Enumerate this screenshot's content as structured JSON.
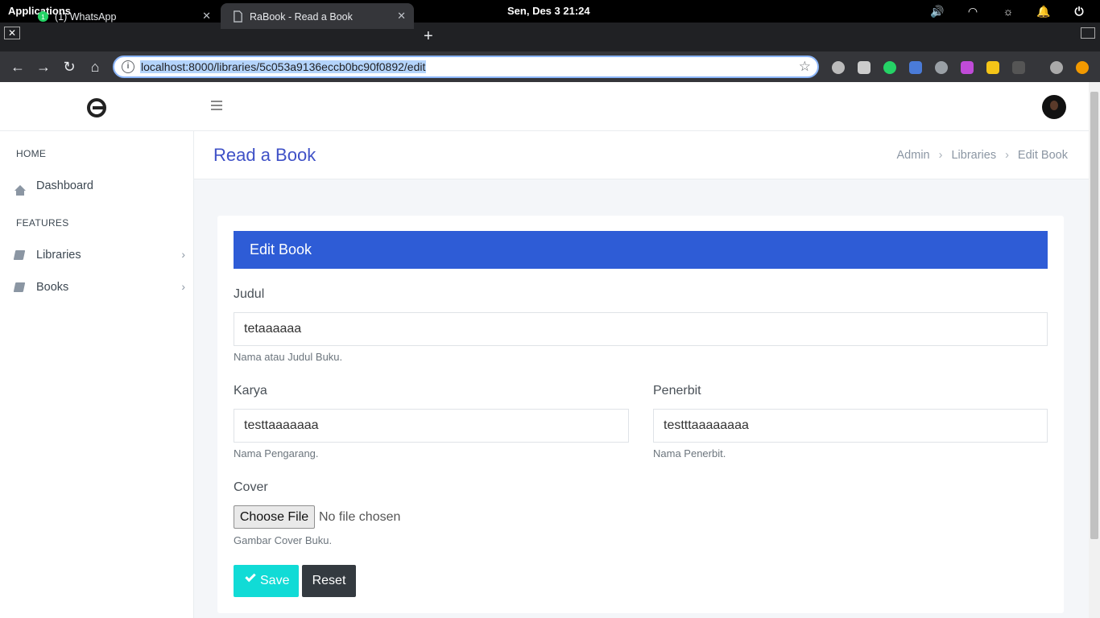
{
  "os": {
    "applications_label": "Applications",
    "clock": "Sen, Des 3    21:24"
  },
  "browser": {
    "tabs": [
      {
        "title": "(1) WhatsApp",
        "active": false
      },
      {
        "title": "RaBook - Read a Book",
        "active": true
      }
    ],
    "url": "localhost:8000/libraries/5c053a9136eccb0bc90f0892/edit",
    "whatsapp_badge": "1",
    "ext_badge": "1"
  },
  "sidebar": {
    "sections": [
      {
        "label": "HOME"
      },
      {
        "label": "FEATURES"
      }
    ],
    "items": [
      {
        "label": "Dashboard",
        "icon": "home-icon"
      },
      {
        "label": "Libraries",
        "icon": "book-icon"
      },
      {
        "label": "Books",
        "icon": "book-icon"
      }
    ]
  },
  "page": {
    "title": "Read a Book",
    "breadcrumb": [
      "Admin",
      "Libraries",
      "Edit Book"
    ]
  },
  "form": {
    "heading": "Edit Book",
    "judul": {
      "label": "Judul",
      "value": "tetaaaaaa",
      "help": "Nama atau Judul Buku."
    },
    "karya": {
      "label": "Karya",
      "value": "testtaaaaaaa",
      "help": "Nama Pengarang."
    },
    "penerbit": {
      "label": "Penerbit",
      "value": "testttaaaaaaaa",
      "help": "Nama Penerbit."
    },
    "cover": {
      "label": "Cover",
      "button": "Choose File",
      "status": "No file chosen",
      "help": "Gambar Cover Buku."
    },
    "save_label": "Save",
    "reset_label": "Reset"
  },
  "colors": {
    "accent": "#2e5cd6",
    "title": "#3f51c7",
    "save": "#11dbd6",
    "reset": "#343a40"
  }
}
